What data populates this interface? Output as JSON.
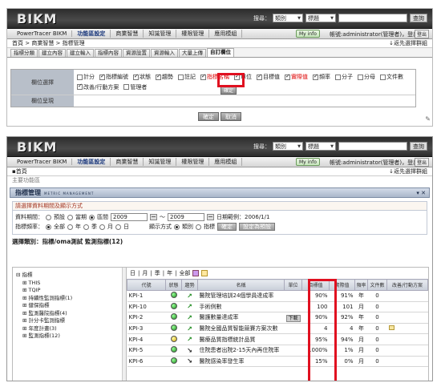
{
  "header": {
    "logo": "BIKM",
    "search_label": "搜尋：",
    "category_select": "類別",
    "title_select": "標題",
    "search_button": "查詢"
  },
  "menu": {
    "items": [
      "PowerTracer BIKM",
      "功能區設定",
      "商業智慧",
      "知識管理",
      "權限管理",
      "應用模組"
    ],
    "active_index": 1,
    "myinfo": "My info",
    "account": "帳號:administrator(管理者)，登出",
    "logout": "登出"
  },
  "shot1": {
    "breadcrumb": "首頁 > 商業智慧 > 指標管理",
    "back_link": "返先選擇群組",
    "tabs": [
      "指標分類",
      "建立內容",
      "建立輸入",
      "指標內容",
      "資源設置",
      "資源輸入",
      "大量上傳",
      "自訂欄位"
    ],
    "active_tab": 7,
    "column_label": "欄位選擇",
    "display_label": "欄位呈現",
    "fields": [
      {
        "label": "計分",
        "checked": false,
        "red": false
      },
      {
        "label": "指標編號",
        "checked": true,
        "red": false
      },
      {
        "label": "狀態",
        "checked": true,
        "red": false
      },
      {
        "label": "趨勢",
        "checked": true,
        "red": false
      },
      {
        "label": "註記",
        "checked": false,
        "red": false
      },
      {
        "label": "指標名稱",
        "checked": true,
        "red": true
      },
      {
        "label": "單位",
        "checked": true,
        "red": false
      },
      {
        "label": "目標值",
        "checked": true,
        "red": false
      },
      {
        "label": "實際值",
        "checked": true,
        "red": true
      },
      {
        "label": "頻率",
        "checked": true,
        "red": false
      },
      {
        "label": "分子",
        "checked": false,
        "red": false
      },
      {
        "label": "分母",
        "checked": false,
        "red": false
      },
      {
        "label": "文件數",
        "checked": false,
        "red": false
      },
      {
        "label": "改善/行動方案",
        "checked": true,
        "red": false
      },
      {
        "label": "管理者",
        "checked": false,
        "red": false
      }
    ],
    "inner_confirm": "確定",
    "confirm": "確定",
    "cancel": "取消"
  },
  "shot2": {
    "breadcrumb": "首頁",
    "back_link": "返先選擇群組",
    "sub_crumb": "主要功能區",
    "page_title": "指標管理",
    "page_title_en": "METRIC MANAGEMENT",
    "section_title": "請選擇資料期間及顯示方式",
    "period_label": "資料期間：",
    "period_options": [
      "預設",
      "當期",
      "區間"
    ],
    "period_selected": 2,
    "date_from": "2009",
    "date_sep": "～",
    "date_to": "2009",
    "date_range_label": "日期範例：2006/1/1",
    "freq_label": "指標頻率：",
    "freq_options": [
      "全部",
      "年",
      "季",
      "月",
      "日"
    ],
    "freq_selected": 0,
    "display_label": "顯示方式",
    "display_options": [
      "類別",
      "指標"
    ],
    "display_selected": 0,
    "confirm_button": "確定",
    "preset_button": "設定為預設",
    "category_title": "選擇類別：指標/oma測試 監測指標(12)",
    "tree": [
      "⊟ 指標",
      "  ⊞ THIS",
      "  ⊞ TQIP",
      "  ⊞ 持續性監測指標(1)",
      "  ⊞ 健保指標",
      "  ⊞ 監測醫院指標(4)",
      "  ⊞ 計分卡監測指標",
      "  ⊞ 年度計畫(3)",
      "  ⊞ 監測指標(12)"
    ],
    "period_links": [
      "日",
      "月",
      "季",
      "年",
      "全部"
    ],
    "columns": [
      "代號",
      "狀態",
      "趨勢",
      "名稱",
      "單位",
      "目標值",
      "實際值",
      "頻率",
      "文件數",
      "改善/行動方案"
    ],
    "rows": [
      {
        "code": "KPI-1",
        "status": "green",
        "trend": "up",
        "name": "醫院管理培訓24個學員達成率",
        "note": "",
        "target": "90%",
        "actual": "91%",
        "freq": "年",
        "docs": "0",
        "doc_icon": false
      },
      {
        "code": "KPI-10",
        "status": "green",
        "trend": "up",
        "name": "手術例數",
        "note": "",
        "target": "100",
        "actual": "101",
        "freq": "月",
        "docs": "0",
        "doc_icon": false
      },
      {
        "code": "KPI-2",
        "status": "green",
        "trend": "up",
        "name": "醫護數量達成率",
        "note": "下載",
        "target": "90%",
        "actual": "92%",
        "freq": "年",
        "docs": "0",
        "doc_icon": false
      },
      {
        "code": "KPI-3",
        "status": "green",
        "trend": "up",
        "name": "醫院全國品質智能競賽方案次數",
        "note": "",
        "target": "4",
        "actual": "4",
        "freq": "年",
        "docs": "0",
        "doc_icon": true
      },
      {
        "code": "KPI-4",
        "status": "yellow",
        "trend": "up",
        "name": "醫療品質指標統計品質",
        "note": "",
        "target": "95%",
        "actual": "94%",
        "freq": "月",
        "docs": "0",
        "doc_icon": false
      },
      {
        "code": "KPI-5",
        "status": "green",
        "trend": "down",
        "name": "住院患者出院2-15天內再住院率",
        "note": "",
        "target": "1000%",
        "actual": "1%",
        "freq": "月",
        "docs": "0",
        "doc_icon": false
      },
      {
        "code": "KPI-6",
        "status": "green",
        "trend": "down",
        "name": "醫院感染率發生率",
        "note": "",
        "target": "15%",
        "actual": "0%",
        "freq": "月",
        "docs": "0",
        "doc_icon": false
      }
    ]
  }
}
